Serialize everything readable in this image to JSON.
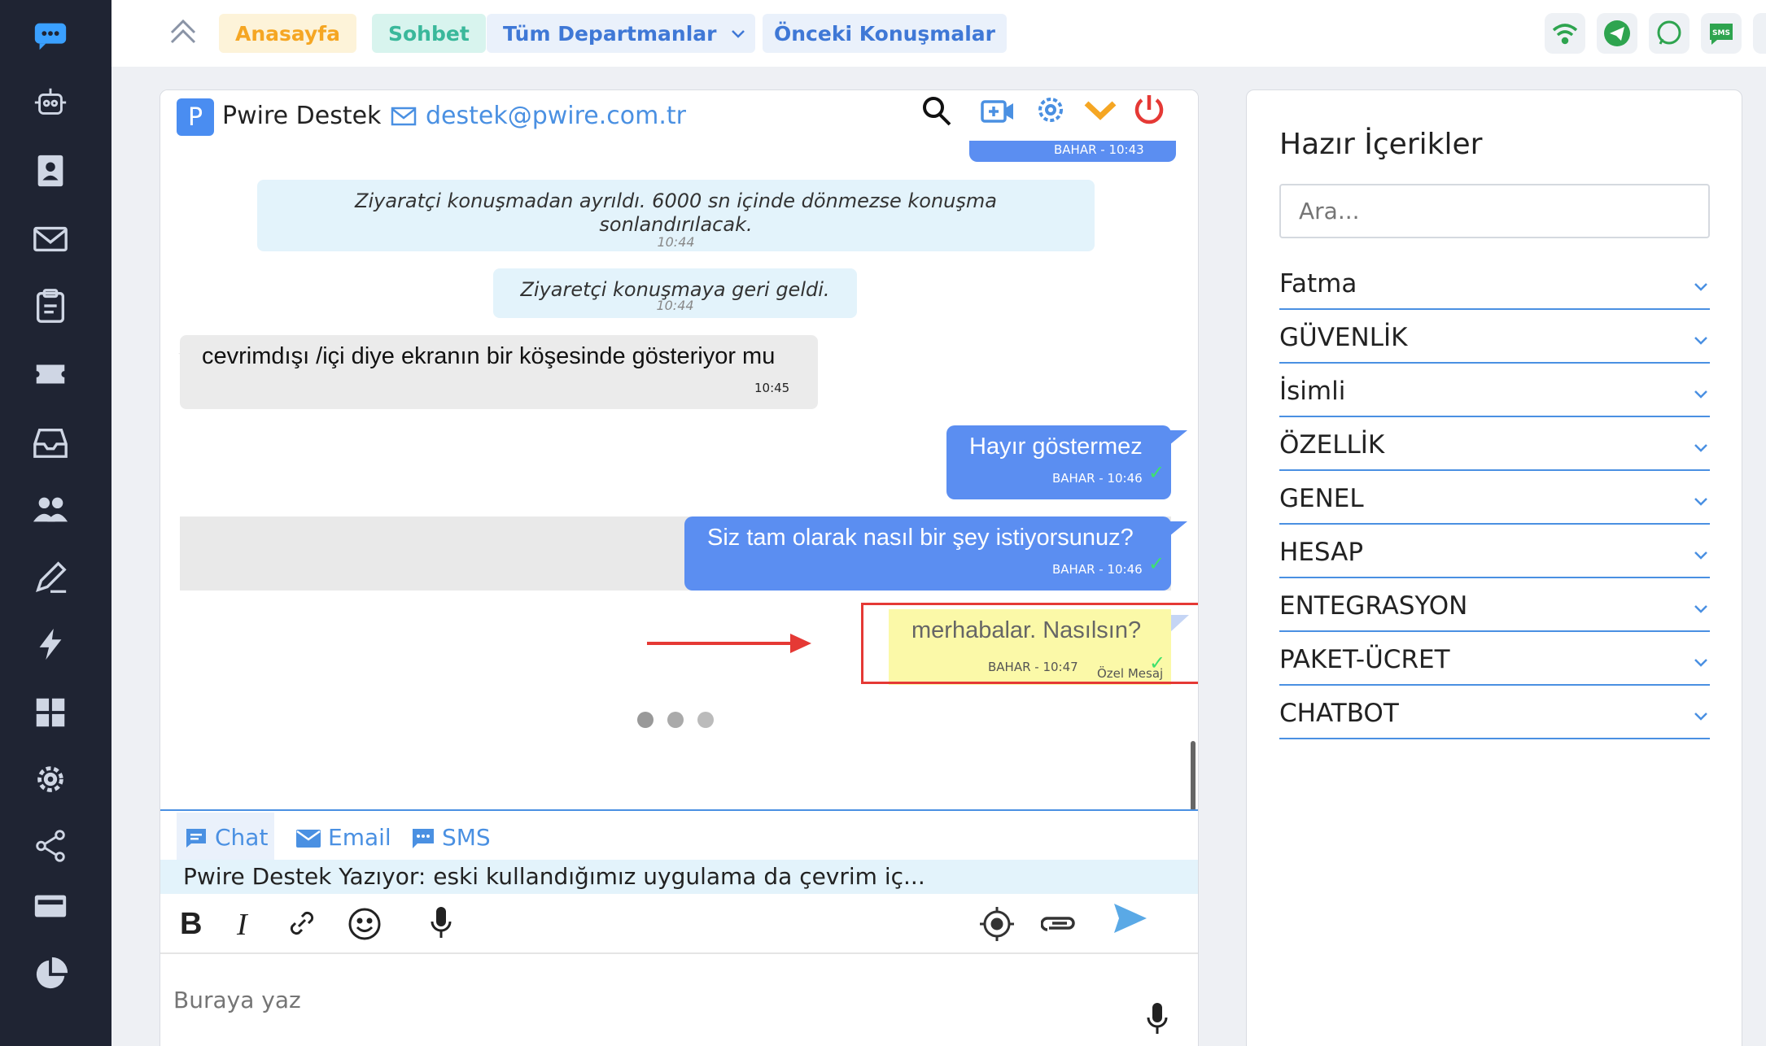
{
  "topbar": {
    "home": "Anasayfa",
    "chat": "Sohbet",
    "departments": "Tüm Departmanlar",
    "previous": "Önceki Konuşmalar"
  },
  "chat": {
    "agent_initial": "P",
    "agent_name": "Pwire Destek",
    "agent_email": "destek@pwire.com.tr",
    "prev_bubble_meta": "BAHAR - 10:43",
    "messages": [
      {
        "text": "Ziyaratçi konuşmadan ayrıldı. 6000 sn içinde dönmezse konuşma sonlandırılacak.",
        "time": "10:44"
      },
      {
        "text": "Ziyaretçi konuşmaya geri geldi.",
        "time": "10:44"
      },
      {
        "text": "cevrimdışı /içi diye ekranın bir köşesinde gösteriyor mu",
        "time": "10:45"
      },
      {
        "text": "Hayır göstermez",
        "meta": "BAHAR - 10:46"
      },
      {
        "text": "Siz tam olarak nasıl bir şey istiyorsunuz?",
        "meta": "BAHAR - 10:46"
      },
      {
        "text": "merhabalar. Nasılsın?",
        "meta": "BAHAR - 10:47",
        "tag": "Özel Mesaj"
      }
    ],
    "tabs": [
      "Chat",
      "Email",
      "SMS"
    ],
    "typing": "Pwire Destek Yazıyor: eski kullandığımız uygulama da çevrim iç...",
    "placeholder": "Buraya yaz"
  },
  "right": {
    "title": "Hazır İçerikler",
    "search_placeholder": "Ara...",
    "categories": [
      "Fatma",
      "GÜVENLİK",
      "İsimli",
      "ÖZELLİK",
      "GENEL",
      "HESAP",
      "ENTEGRASYON",
      "PAKET-ÜCRET",
      "CHATBOT"
    ]
  },
  "colors": {
    "sidebar": "#1f2433",
    "accent_blue": "#4a90e2",
    "bubble_blue": "#5b8ef1",
    "highlight_red": "#e53935",
    "private_yellow": "#fbf9a8"
  }
}
